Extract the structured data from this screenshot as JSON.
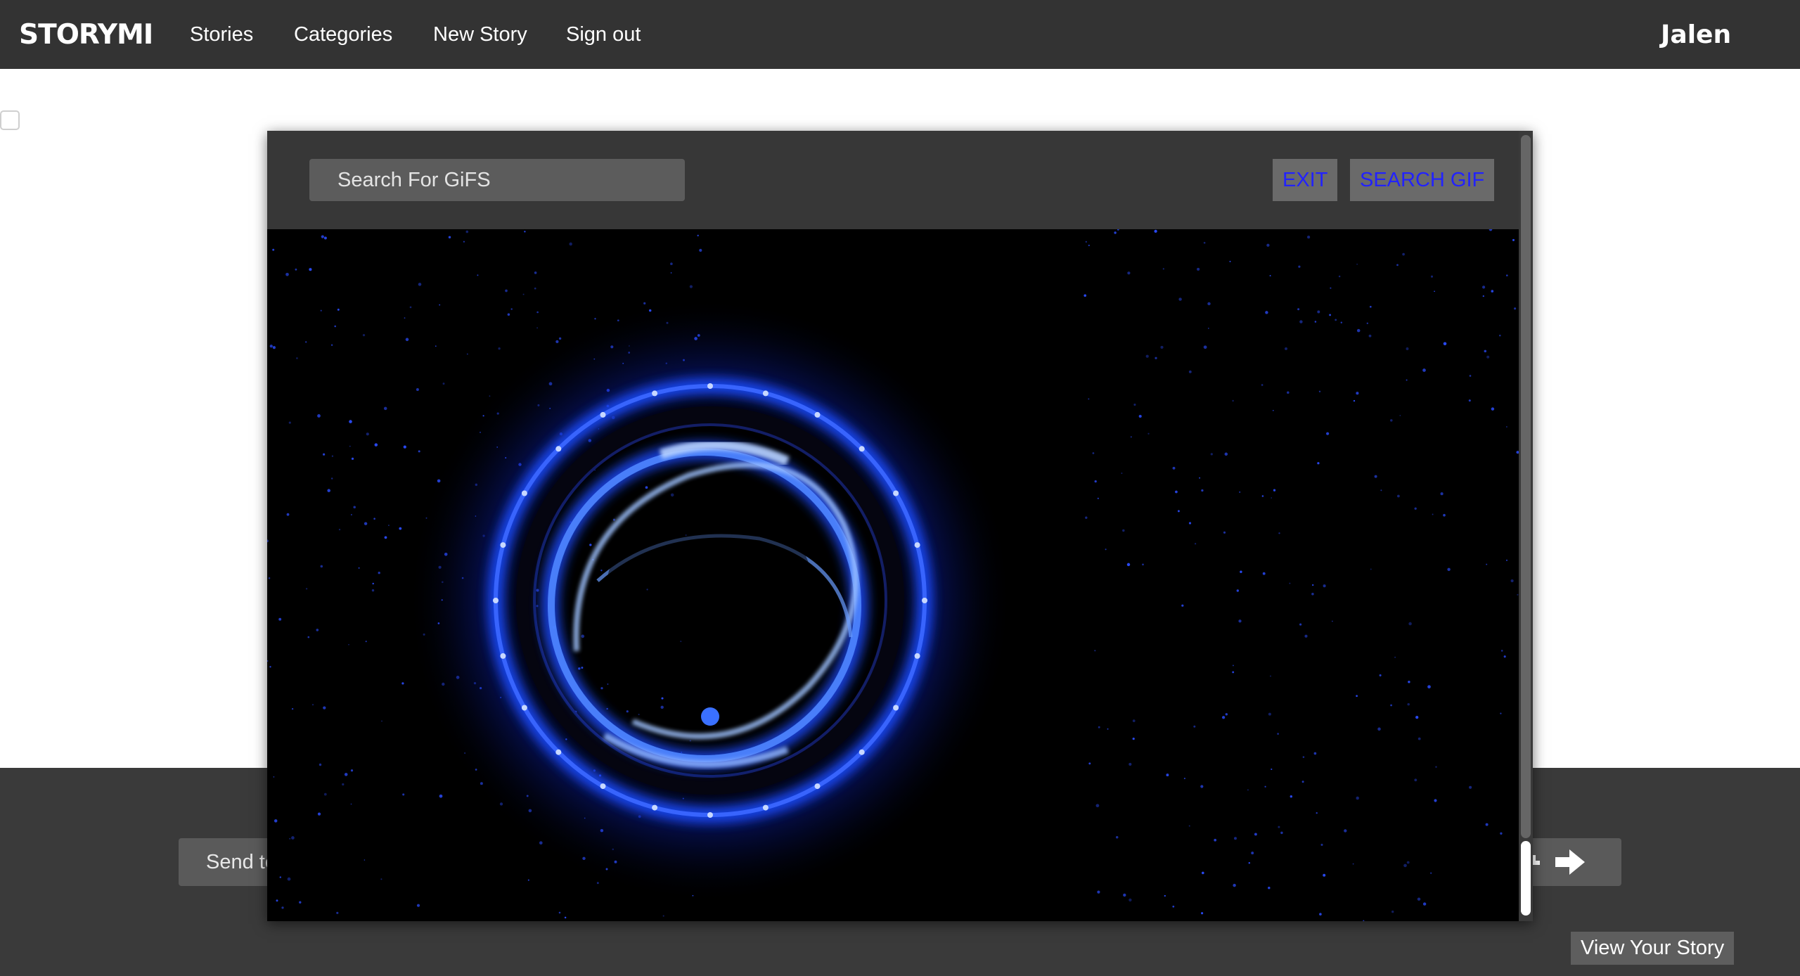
{
  "navbar": {
    "brand": "STORYMI",
    "links": [
      "Stories",
      "Categories",
      "New Story",
      "Sign out"
    ],
    "user": "Jalen"
  },
  "composer": {
    "input_text": "Send te",
    "send_icon": "arrow-right-icon"
  },
  "view_story_label": "View Your Story",
  "gif_modal": {
    "search_placeholder": "Search For GiFS",
    "exit_label": "EXIT",
    "search_label": "SEARCH GIF",
    "button_text_color": "#2222ff",
    "gif_description_colors": {
      "ring": "#2a5cff",
      "background": "#000000"
    }
  },
  "colors": {
    "navbar": "#333333",
    "bottom_bar": "#3a3a3a",
    "accent": "#2222ff"
  }
}
